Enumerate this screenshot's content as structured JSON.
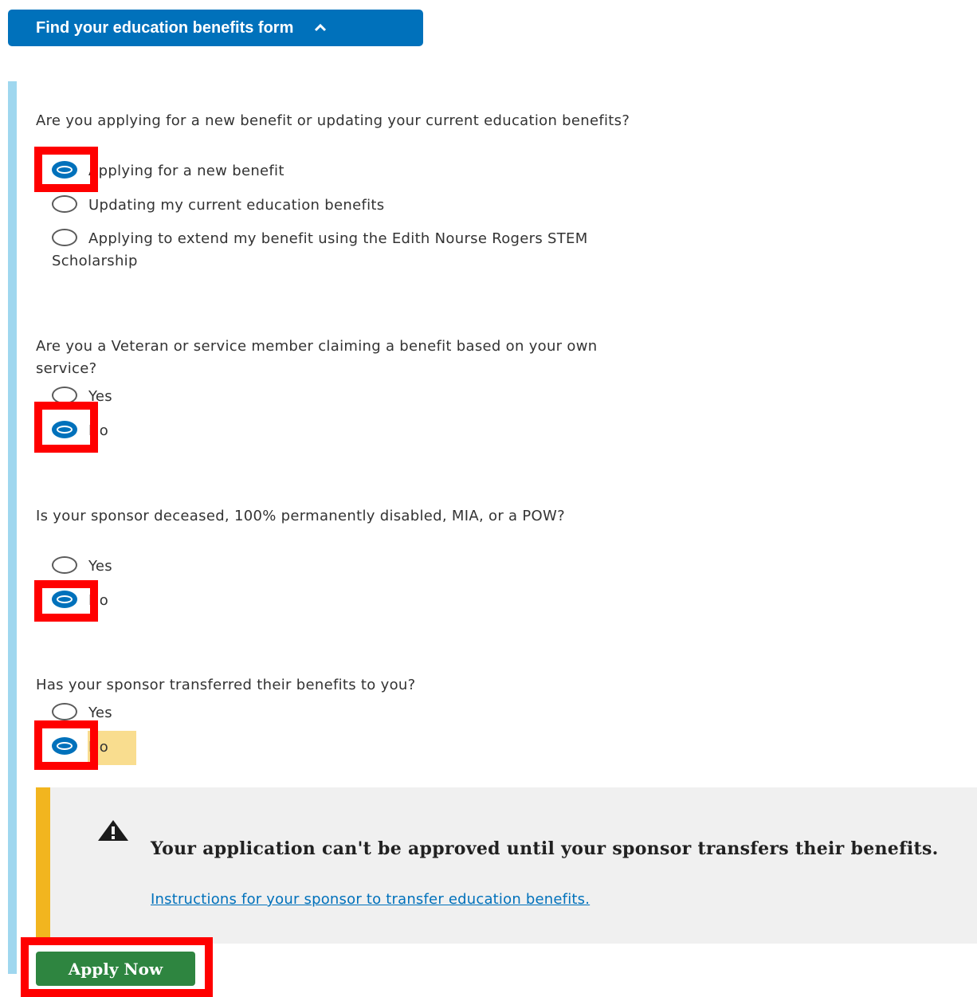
{
  "header": {
    "toggle_label": "Find your education benefits form",
    "icon": "chevron-up-icon"
  },
  "questions": [
    {
      "text": "Are you applying for a new benefit or updating your current education benefits?",
      "options": [
        "Applying for a new benefit",
        "Updating my current education benefits",
        "Applying to extend my benefit using the Edith Nourse Rogers STEM Scholarship"
      ],
      "selected": "Applying for a new benefit"
    },
    {
      "text": "Are you a Veteran or service member claiming a benefit based on your own service?",
      "options": [
        "Yes",
        "No"
      ],
      "selected": "No"
    },
    {
      "text": "Is your sponsor deceased, 100% permanently disabled, MIA, or a POW?",
      "options": [
        "Yes",
        "No"
      ],
      "selected": "No"
    },
    {
      "text": "Has your sponsor transferred their benefits to you?",
      "options": [
        "Yes",
        "No"
      ],
      "selected": "No"
    }
  ],
  "alert": {
    "icon": "warning-icon",
    "heading": "Your application can't be approved until your sponsor transfers their benefits.",
    "link": "Instructions for your sponsor to transfer education benefits."
  },
  "apply_button": "Apply Now",
  "colors": {
    "primary": "#0071bb",
    "success": "#2e8540",
    "warning": "#f2b51f",
    "highlight": "#ff0000"
  }
}
